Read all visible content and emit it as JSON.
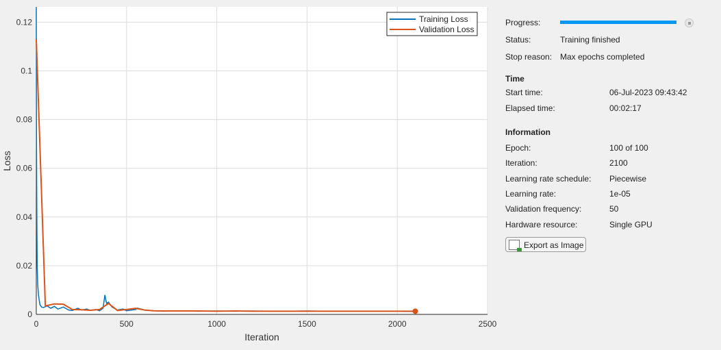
{
  "chart_data": {
    "type": "line",
    "xlabel": "Iteration",
    "ylabel": "Loss",
    "xlim": [
      0,
      2500
    ],
    "ylim": [
      0,
      0.1263
    ],
    "xticks": [
      "0",
      "500",
      "1000",
      "1500",
      "2000",
      "2500"
    ],
    "yticks": [
      "0",
      "0.02",
      "0.04",
      "0.06",
      "0.08",
      "0.1",
      "0.12"
    ],
    "grid": true,
    "legend_position": "top-right",
    "series": [
      {
        "name": "Training Loss",
        "color": "#0072bd",
        "x": [
          0,
          1,
          3,
          5,
          8,
          12,
          16,
          20,
          30,
          40,
          60,
          80,
          100,
          120,
          150,
          180,
          200,
          230,
          250,
          280,
          300,
          330,
          350,
          370,
          380,
          385,
          390,
          400,
          420,
          450,
          480,
          500,
          550,
          560,
          600,
          650,
          700,
          800,
          900,
          1000,
          1100,
          1200,
          1300,
          1400,
          1500,
          1600,
          1700,
          1800,
          1900,
          2000,
          2050,
          2100
        ],
        "y": [
          0.126,
          0.071,
          0.04,
          0.02,
          0.012,
          0.008,
          0.006,
          0.004,
          0.003,
          0.0028,
          0.0035,
          0.0025,
          0.0033,
          0.0022,
          0.003,
          0.0018,
          0.0016,
          0.0025,
          0.0018,
          0.0022,
          0.0016,
          0.002,
          0.0015,
          0.0025,
          0.008,
          0.006,
          0.0045,
          0.005,
          0.003,
          0.0018,
          0.0022,
          0.0015,
          0.002,
          0.0026,
          0.0018,
          0.0015,
          0.0013,
          0.0014,
          0.0013,
          0.0014,
          0.0013,
          0.0014,
          0.0013,
          0.0013,
          0.0014,
          0.0013,
          0.0013,
          0.0013,
          0.0013,
          0.0013,
          0.0012,
          0.0012
        ]
      },
      {
        "name": "Validation Loss",
        "color": "#d95319",
        "x": [
          0,
          50,
          100,
          150,
          200,
          250,
          300,
          350,
          400,
          450,
          500,
          550,
          600,
          650,
          700,
          800,
          900,
          1000,
          1100,
          1200,
          1300,
          1400,
          1500,
          1600,
          1700,
          1800,
          1900,
          2000,
          2100
        ],
        "y": [
          0.113,
          0.0035,
          0.0043,
          0.0042,
          0.002,
          0.0019,
          0.0017,
          0.002,
          0.0045,
          0.0016,
          0.002,
          0.0025,
          0.0018,
          0.0015,
          0.0014,
          0.0014,
          0.0014,
          0.0013,
          0.0014,
          0.0013,
          0.0013,
          0.0013,
          0.0013,
          0.0013,
          0.0013,
          0.0013,
          0.0013,
          0.0013,
          0.0013
        ]
      }
    ]
  },
  "panel": {
    "progress_label": "Progress:",
    "progress": 1.0,
    "status_label": "Status:",
    "status": "Training finished",
    "stop_label": "Stop reason:",
    "stop": "Max epochs completed",
    "time_header": "Time",
    "start_label": "Start time:",
    "start": "06-Jul-2023 09:43:42",
    "elapsed_label": "Elapsed time:",
    "elapsed": "00:02:17",
    "info_header": "Information",
    "info": [
      {
        "label": "Epoch:",
        "value": "100 of 100"
      },
      {
        "label": "Iteration:",
        "value": "2100"
      },
      {
        "label": "Learning rate schedule:",
        "value": "Piecewise"
      },
      {
        "label": "Learning rate:",
        "value": "1e-05"
      },
      {
        "label": "Validation frequency:",
        "value": "50"
      },
      {
        "label": "Hardware resource:",
        "value": "Single GPU"
      }
    ],
    "export_label": "Export as Image"
  }
}
